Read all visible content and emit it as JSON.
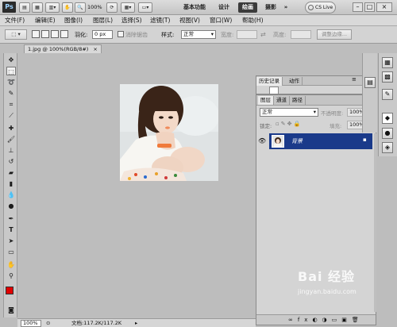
{
  "app": {
    "logo": "Ps"
  },
  "appbar": {
    "zoom": "100%",
    "workspaces": [
      "基本功能",
      "设计",
      "绘画",
      "摄影"
    ],
    "active_workspace": "绘画",
    "more": "»",
    "cslive": "CS Live",
    "win_min": "–",
    "win_max": "□",
    "win_close": "×"
  },
  "menu": [
    "文件(F)",
    "编辑(E)",
    "图像(I)",
    "图层(L)",
    "选择(S)",
    "滤镜(T)",
    "视图(V)",
    "窗口(W)",
    "帮助(H)"
  ],
  "options": {
    "feather_label": "羽化:",
    "feather_value": "0 px",
    "antialias_label": "消除锯齿",
    "style_label": "样式:",
    "style_value": "正常",
    "width_label": "宽度:",
    "height_label": "高度:",
    "refine_button": "调整边缘..."
  },
  "document": {
    "tab": "1.jpg @ 100%(RGB/8#)"
  },
  "status": {
    "zoom": "100%",
    "doc": "文档:117.2K/117.2K"
  },
  "history": {
    "tabs": [
      "历史记录",
      "动作"
    ]
  },
  "layers": {
    "tabs": [
      "图层",
      "通道",
      "路径"
    ],
    "blend": "正常",
    "opacity_label": "不透明度:",
    "opacity": "100%",
    "lock_label": "锁定:",
    "fill_label": "填充:",
    "fill": "100%",
    "layer_name": "背景"
  },
  "watermark": {
    "brand": "Bai 经验",
    "url": "jingyan.baidu.com"
  },
  "colors": {
    "fg": "#e00000",
    "bg": "#ffffff",
    "layer_select": "#1a3a8a"
  }
}
